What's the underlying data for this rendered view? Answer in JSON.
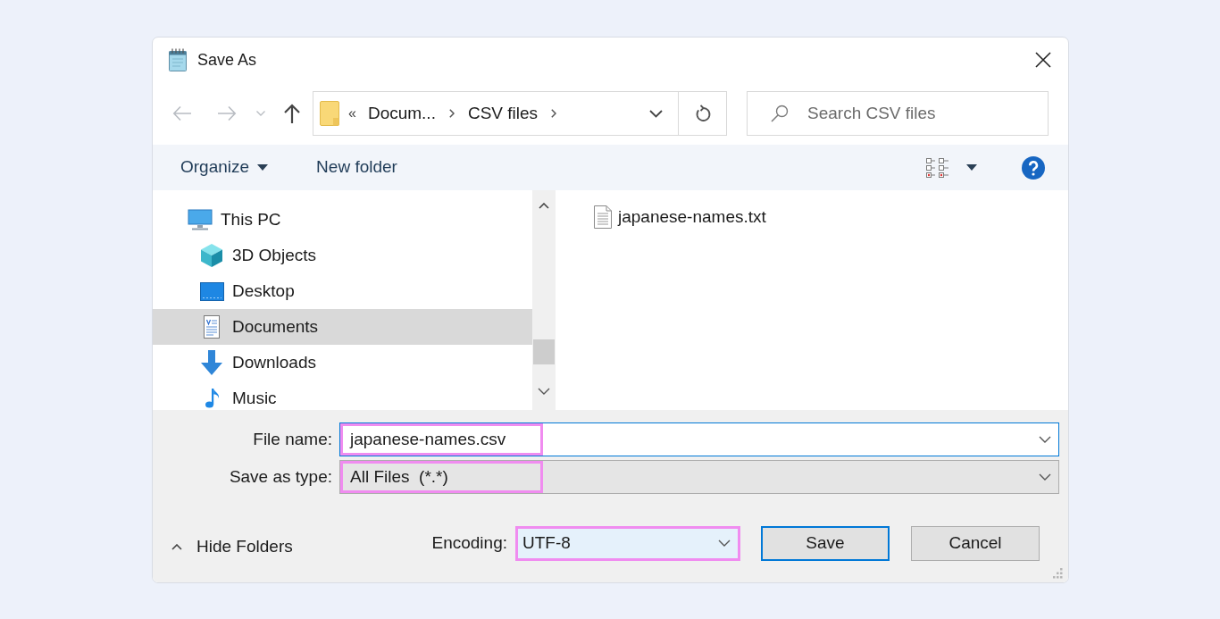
{
  "window": {
    "title": "Save As"
  },
  "address_bar": {
    "overflow_marker": "«",
    "segments": [
      "Docum...",
      "CSV files"
    ]
  },
  "search": {
    "placeholder": "Search CSV files"
  },
  "toolbar": {
    "items": [
      {
        "label": "Organize",
        "menu": true
      },
      {
        "label": "New folder",
        "menu": false
      }
    ]
  },
  "navigation_pane": {
    "items": [
      {
        "label": "This PC",
        "selected": false,
        "children": [
          {
            "label": "3D Objects",
            "selected": false
          },
          {
            "label": "Desktop",
            "selected": false
          },
          {
            "label": "Documents",
            "selected": true
          },
          {
            "label": "Downloads",
            "selected": false
          },
          {
            "label": "Music",
            "selected": false
          }
        ]
      }
    ]
  },
  "files": [
    {
      "name": "japanese-names.txt"
    }
  ],
  "file_name": {
    "label": "File name:",
    "value": "japanese-names.csv",
    "focused": true,
    "highlighted": true
  },
  "save_as_type": {
    "label": "Save as type:",
    "value": "All Files  (*.*)",
    "highlighted": true
  },
  "hide_folders": {
    "label": "Hide Folders"
  },
  "encoding": {
    "label": "Encoding:",
    "value": "UTF-8",
    "highlighted": true
  },
  "buttons": [
    {
      "label": "Save",
      "default": true
    },
    {
      "label": "Cancel",
      "default": false
    }
  ]
}
